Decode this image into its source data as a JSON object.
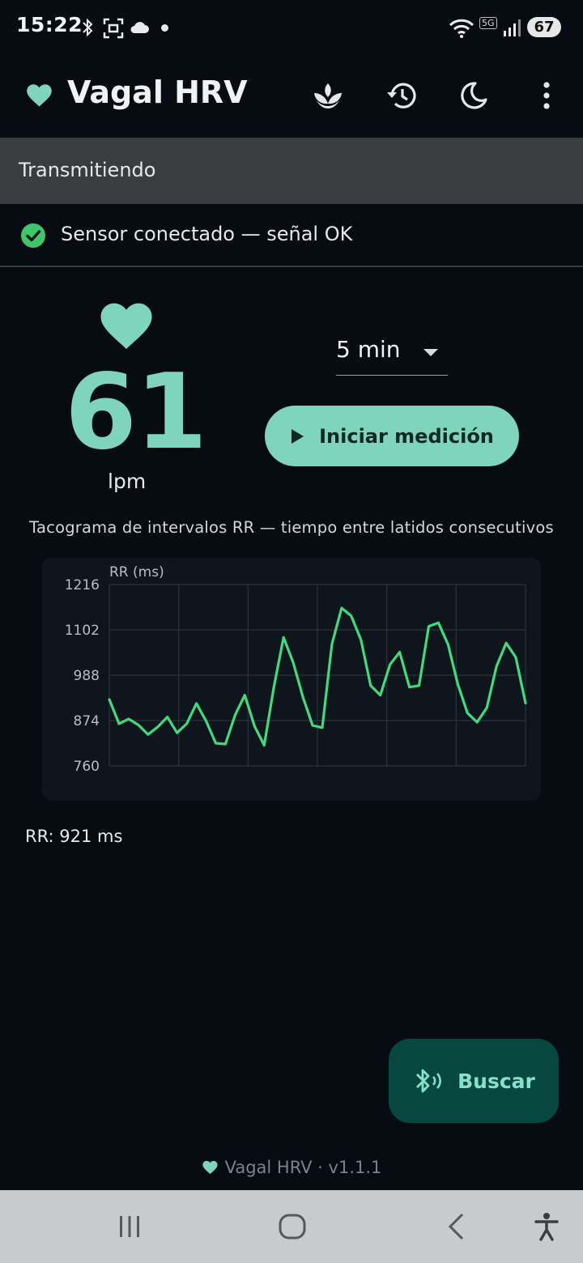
{
  "status_bar": {
    "time": "15:22",
    "network_label": "5G",
    "battery": "67",
    "icons": [
      "bluetooth-icon",
      "screenshot-icon",
      "cloud-icon",
      "dot-icon",
      "wifi-icon",
      "signal-icon"
    ]
  },
  "app_bar": {
    "title": "Vagal HRV",
    "logo_icon": "heart-icon",
    "actions": [
      "meditation-icon",
      "history-icon",
      "night-mode-icon",
      "more-vert-icon"
    ]
  },
  "banner": {
    "text": "Transmitiendo"
  },
  "sensor": {
    "status": "Sensor conectado — señal OK",
    "status_icon": "check-circle-icon"
  },
  "heart_rate": {
    "value": "61",
    "unit": "lpm"
  },
  "duration": {
    "selected": "5 min"
  },
  "start_button": {
    "label": "Iniciar medición"
  },
  "chart_caption": "Tacograma de intervalos RR — tiempo entre latidos consecutivos",
  "chart_data": {
    "type": "line",
    "ylabel": "RR (ms)",
    "xlabel": "",
    "ylim": [
      760,
      1216
    ],
    "yticks": [
      1216,
      1102,
      988,
      874,
      760
    ],
    "grid": true,
    "series": [
      {
        "color": "#3fdb7d",
        "values": [
          927,
          866,
          878,
          863,
          839,
          858,
          883,
          843,
          866,
          917,
          873,
          817,
          815,
          888,
          938,
          860,
          812,
          958,
          1083,
          1020,
          933,
          862,
          856,
          1066,
          1157,
          1137,
          1077,
          962,
          938,
          1015,
          1046,
          958,
          962,
          1111,
          1120,
          1065,
          966,
          893,
          870,
          906,
          1010,
          1069,
          1033,
          918
        ]
      }
    ]
  },
  "rr_readout": "RR: 921 ms",
  "fab": {
    "label": "Buscar",
    "icon": "bluetooth-search-icon"
  },
  "footer": {
    "text": "Vagal HRV · v1.1.1",
    "icon": "heart-icon"
  },
  "nav_bar": {
    "buttons": [
      "recent-apps-icon",
      "home-icon",
      "back-icon",
      "accessibility-icon"
    ]
  }
}
